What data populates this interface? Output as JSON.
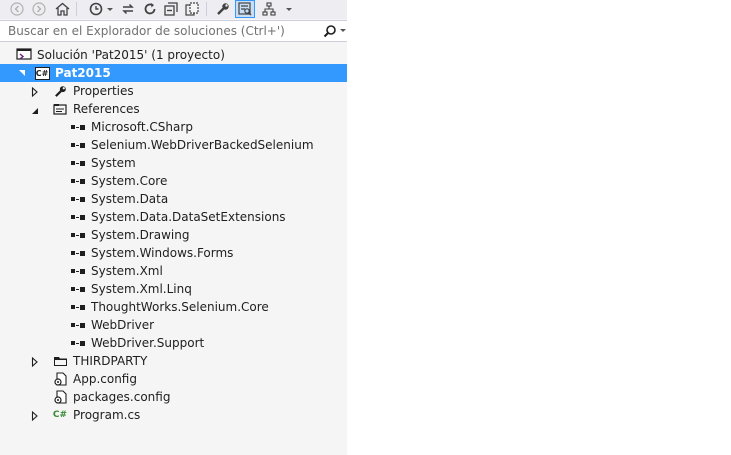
{
  "search": {
    "placeholder": "Buscar en el Explorador de soluciones (Ctrl+')"
  },
  "toolbar": {
    "items": [
      "back-icon",
      "forward-icon",
      "home-icon",
      "pending-changes-filter-icon",
      "sync-icon",
      "refresh-icon",
      "collapse-all-icon",
      "show-all-files-icon",
      "properties-icon",
      "preview-icon",
      "class-view-icon"
    ]
  },
  "tree": {
    "solution": "Solución 'Pat2015'  (1 proyecto)",
    "project": "Pat2015",
    "properties": "Properties",
    "references": "References",
    "refs": [
      "Microsoft.CSharp",
      "Selenium.WebDriverBackedSelenium",
      "System",
      "System.Core",
      "System.Data",
      "System.Data.DataSetExtensions",
      "System.Drawing",
      "System.Windows.Forms",
      "System.Xml",
      "System.Xml.Linq",
      "ThoughtWorks.Selenium.Core",
      "WebDriver",
      "WebDriver.Support"
    ],
    "thirdparty": "THIRDPARTY",
    "appconfig": "App.config",
    "packages": "packages.config",
    "program": "Program.cs",
    "cs_badge": "C#"
  },
  "colors": {
    "selection": "#3399ff",
    "panel_bg": "#f5f5f5",
    "toolbar_bg": "#eeeef2"
  }
}
